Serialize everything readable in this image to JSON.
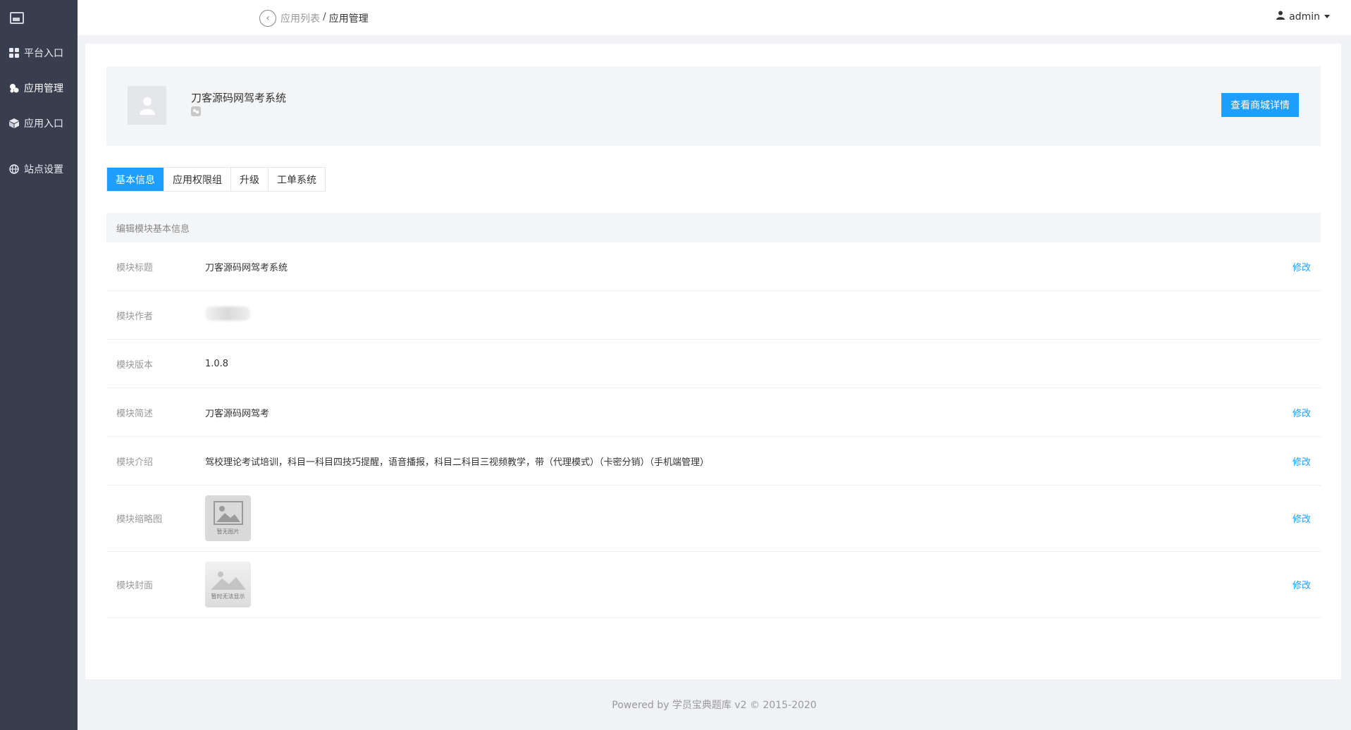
{
  "sidebar": {
    "items": [
      {
        "label": "平台入口",
        "icon": "grid-icon"
      },
      {
        "label": "应用管理",
        "icon": "cubes-icon"
      },
      {
        "label": "应用入口",
        "icon": "cube-icon"
      },
      {
        "label": "站点设置",
        "icon": "globe-icon"
      }
    ]
  },
  "header": {
    "breadcrumb": {
      "parent": "应用列表",
      "separator": "/",
      "current": "应用管理"
    },
    "user": "admin"
  },
  "app": {
    "name": "刀客源码网驾考系统",
    "shop_button": "查看商城详情"
  },
  "tabs": [
    {
      "label": "基本信息",
      "active": true
    },
    {
      "label": "应用权限组",
      "active": false
    },
    {
      "label": "升级",
      "active": false
    },
    {
      "label": "工单系统",
      "active": false
    }
  ],
  "section_title": "编辑模块基本信息",
  "fields": {
    "title": {
      "label": "模块标题",
      "value": "刀客源码网驾考系统",
      "edit": "修改"
    },
    "author": {
      "label": "模块作者"
    },
    "version": {
      "label": "模块版本",
      "value": "1.0.8"
    },
    "summary": {
      "label": "模块简述",
      "value": "刀客源码网驾考",
      "edit": "修改"
    },
    "intro": {
      "label": "模块介绍",
      "value": "驾校理论考试培训，科目一科目四技巧提醒，语音播报，科目二科目三视频教学，带（代理模式）（卡密分销）（手机端管理）",
      "edit": "修改"
    },
    "thumbnail": {
      "label": "模块缩略图",
      "caption": "暂无图片",
      "edit": "修改"
    },
    "cover": {
      "label": "模块封面",
      "caption": "暂时无法显示",
      "edit": "修改"
    }
  },
  "footer": "Powered by 学员宝典题库 v2 © 2015-2020",
  "colors": {
    "sidebar": "#393e4f",
    "accent": "#1e9fff"
  }
}
